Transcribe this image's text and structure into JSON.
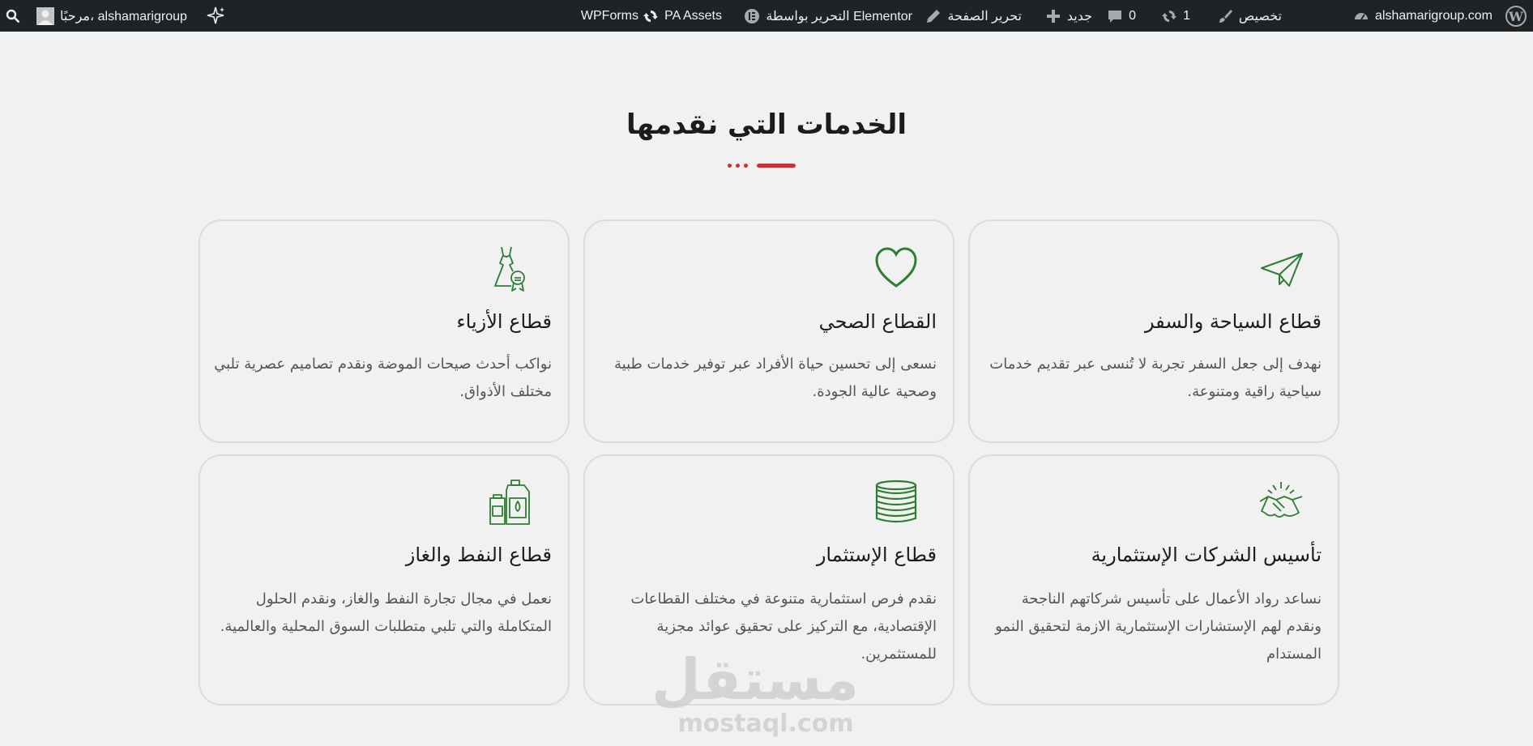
{
  "adminbar": {
    "site_name": "alshamarigroup.com",
    "customize": "تخصيص",
    "updates_count": "1",
    "comments_count": "0",
    "new": "جديد",
    "edit_page": "تحرير الصفحة",
    "edit_elementor": "التحرير بواسطة Elementor",
    "pa_assets": "PA Assets",
    "wpforms": "WPForms",
    "greeting": "مرحبًا، alshamarigroup",
    "icons": [
      "wordpress-logo-icon",
      "dashboard-icon",
      "brush-icon",
      "updates-icon",
      "comment-icon",
      "plus-icon",
      "pencil-icon",
      "elementor-icon",
      "refresh-icon",
      "sparkle-icon",
      "avatar",
      "search-icon"
    ]
  },
  "section": {
    "title": "الخدمات التي نقدمها",
    "accent_color": "#d32f2f",
    "icon_color": "#2e7d32"
  },
  "cards": [
    {
      "title": "قطاع السياحة والسفر",
      "desc": "نهدف إلى جعل السفر تجربة لا تُنسى عبر تقديم خدمات سياحية راقية ومتنوعة.",
      "icon": "paper-plane-icon"
    },
    {
      "title": "القطاع الصحي",
      "desc": "نسعى إلى تحسين حياة الأفراد عبر توفير خدمات طبية وصحية عالية الجودة.",
      "icon": "heart-icon"
    },
    {
      "title": "قطاع الأزياء",
      "desc": "نواكب أحدث صيحات الموضة ونقدم تصاميم عصرية تلبي مختلف الأذواق.",
      "icon": "dress-icon"
    },
    {
      "title": "تأسيس الشركات الإستثمارية",
      "desc": "نساعد رواد الأعمال على تأسيس شركاتهم الناجحة ونقدم لهم الإستشارات الإستثمارية الازمة لتحقيق النمو المستدام",
      "icon": "handshake-icon"
    },
    {
      "title": "قطاع الإستثمار",
      "desc": "نقدم فرص استثمارية متنوعة في مختلف القطاعات الإقتصادية، مع التركيز على تحقيق عوائد مجزية للمستثمرين.",
      "icon": "coins-icon"
    },
    {
      "title": "قطاع النفط والغاز",
      "desc": "نعمل في مجال تجارة النفط والغاز، ونقدم الحلول المتكاملة والتي تلبي متطلبات السوق المحلية والعالمية.",
      "icon": "oil-can-icon"
    }
  ],
  "watermark": {
    "arabic": "مستقل",
    "latin": "mostaql.com"
  }
}
